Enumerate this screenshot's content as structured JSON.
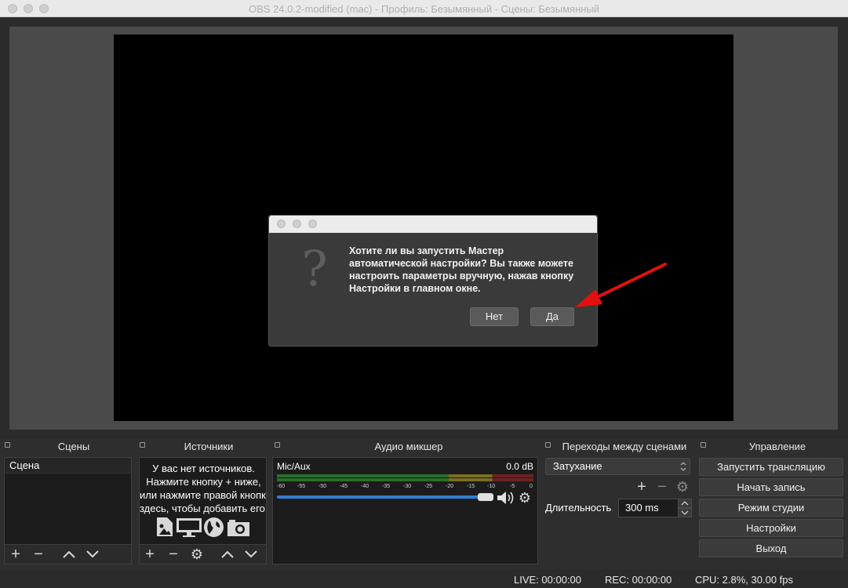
{
  "window": {
    "title": "OBS 24.0.2-modified (mac) - Профиль: Безымянный - Сцены: Безымянный"
  },
  "dialog": {
    "icon": "question-mark-icon",
    "message": "Хотите ли вы запустить Мастер автоматической настройки? Вы также можете настроить параметры вручную, нажав кнопку Настройки в главном окне.",
    "no_label": "Нет",
    "yes_label": "Да",
    "annotation": "red-arrow-pointing-to-yes"
  },
  "scenes": {
    "header": "Сцены",
    "items": [
      "Сцена"
    ]
  },
  "sources": {
    "header": "Источники",
    "empty_lines": [
      "У вас нет источников.",
      "Нажмите кнопку + ниже,",
      "или нажмите правой кнопкой",
      "здесь, чтобы добавить его."
    ],
    "icons": [
      "image-icon",
      "monitor-icon",
      "globe-icon",
      "camera-icon"
    ]
  },
  "mixer": {
    "header": "Аудио микшер",
    "channel": "Mic/Aux",
    "level": "0.0 dB",
    "ticks": [
      "-60",
      "-55",
      "-50",
      "-45",
      "-40",
      "-35",
      "-30",
      "-25",
      "-20",
      "-15",
      "-10",
      "-5",
      "0"
    ],
    "volume": 0.95
  },
  "transitions": {
    "header": "Переходы между сценами",
    "selected": "Затухание",
    "duration_label": "Длительность",
    "duration_value": "300 ms"
  },
  "controls": {
    "header": "Управление",
    "buttons": [
      "Запустить трансляцию",
      "Начать запись",
      "Режим студии",
      "Настройки",
      "Выход"
    ]
  },
  "status": {
    "live": "LIVE: 00:00:00",
    "rec": "REC: 00:00:00",
    "cpu": "CPU: 2.8%, 30.00 fps"
  },
  "colors": {
    "accent": "#2f7fd6",
    "arrow": "#e3100f"
  }
}
